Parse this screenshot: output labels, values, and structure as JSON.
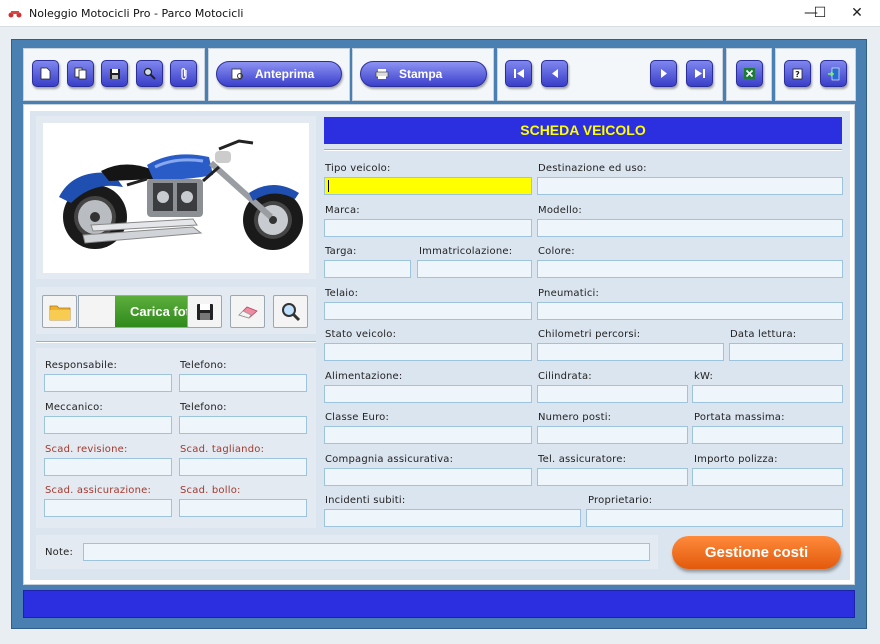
{
  "window": {
    "title": "Noleggio Motocicli Pro - Parco Motocicli",
    "minimize": "—",
    "maximize": "☐",
    "close": "✕"
  },
  "toolbar": {
    "preview_label": "Anteprima",
    "print_label": "Stampa",
    "icons": [
      "new-icon",
      "copy-icon",
      "save-icon",
      "search-icon",
      "attach-icon",
      "first-record-icon",
      "previous-record-icon",
      "next-record-icon",
      "last-record-icon",
      "excel-icon",
      "help-icon",
      "exit-icon"
    ]
  },
  "photo": {
    "load_label": "Carica foto"
  },
  "header_title": "SCHEDA VEICOLO",
  "form": {
    "tipo_veicolo": "Tipo veicolo:",
    "destinazione": "Destinazione ed uso:",
    "marca": "Marca:",
    "modello": "Modello:",
    "targa": "Targa:",
    "immatricolazione": "Immatricolazione:",
    "colore": "Colore:",
    "telaio": "Telaio:",
    "pneumatici": "Pneumatici:",
    "stato_veicolo": "Stato veicolo:",
    "chilometri": "Chilometri percorsi:",
    "data_lettura": "Data lettura:",
    "alimentazione": "Alimentazione:",
    "cilindrata": "Cilindrata:",
    "kw": "kW:",
    "classe_euro": "Classe Euro:",
    "numero_posti": "Numero posti:",
    "portata_massima": "Portata massima:",
    "compagnia": "Compagnia assicurativa:",
    "tel_assicuratore": "Tel. assicuratore:",
    "importo_polizza": "Importo polizza:",
    "incidenti": "Incidenti subiti:",
    "proprietario": "Proprietario:"
  },
  "left": {
    "responsabile": "Responsabile:",
    "telefono1": "Telefono:",
    "meccanico": "Meccanico:",
    "telefono2": "Telefono:",
    "scad_revisione": "Scad. revisione:",
    "scad_tagliando": "Scad. tagliando:",
    "scad_assicurazione": "Scad. assicurazione:",
    "scad_bollo": "Scad. bollo:"
  },
  "notes_label": "Note:",
  "costs_button": "Gestione costi",
  "colors": {
    "accent_blue": "#2b2fe0",
    "header_text": "#ffff00",
    "frame": "#4a7fb1",
    "orange_button": "#f07020",
    "green_button": "#3f9a29",
    "deadline_label": "#a33a2e"
  }
}
